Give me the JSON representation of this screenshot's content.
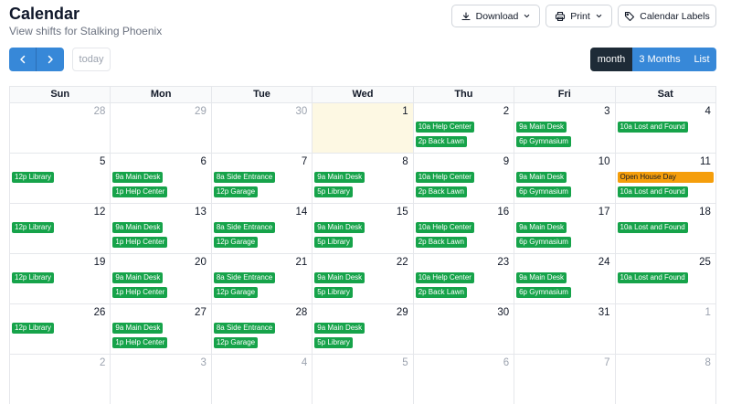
{
  "header": {
    "title": "Calendar",
    "subtitle": "View shifts for Stalking Phoenix"
  },
  "toolbar": {
    "download_label": "Download",
    "print_label": "Print",
    "labels_label": "Calendar Labels",
    "today_label": "today",
    "views": [
      "month",
      "3 Months",
      "List"
    ],
    "active_view": "month"
  },
  "icons": {
    "download": "download-icon",
    "print": "printer-icon",
    "labels": "tag-icon",
    "prev": "chevron-left-icon",
    "next": "chevron-right-icon"
  },
  "colors": {
    "accent": "#3788d8",
    "active_view": "#1e2b37",
    "event": "#16a34a",
    "special_event": "#f59e0b",
    "today_bg": "#fdf8e3"
  },
  "calendar": {
    "weekdays": [
      "Sun",
      "Mon",
      "Tue",
      "Wed",
      "Thu",
      "Fri",
      "Sat"
    ],
    "weeks": [
      [
        {
          "day": "28",
          "other": true,
          "events": []
        },
        {
          "day": "29",
          "other": true,
          "events": []
        },
        {
          "day": "30",
          "other": true,
          "events": []
        },
        {
          "day": "1",
          "today": true,
          "events": []
        },
        {
          "day": "2",
          "events": [
            "10a Help Center",
            "2p Back Lawn"
          ]
        },
        {
          "day": "3",
          "events": [
            "9a Main Desk",
            "6p Gymnasium"
          ]
        },
        {
          "day": "4",
          "events": [
            "10a Lost and Found"
          ]
        }
      ],
      [
        {
          "day": "5",
          "events": [
            "12p Library"
          ]
        },
        {
          "day": "6",
          "events": [
            "9a Main Desk",
            "1p Help Center"
          ]
        },
        {
          "day": "7",
          "events": [
            "8a Side Entrance",
            "12p Garage"
          ]
        },
        {
          "day": "8",
          "events": [
            "9a Main Desk",
            "5p Library"
          ]
        },
        {
          "day": "9",
          "events": [
            "10a Help Center",
            "2p Back Lawn"
          ]
        },
        {
          "day": "10",
          "events": [
            "9a Main Desk",
            "6p Gymnasium"
          ]
        },
        {
          "day": "11",
          "special": "Open House Day",
          "events": [
            "10a Lost and Found"
          ]
        }
      ],
      [
        {
          "day": "12",
          "events": [
            "12p Library"
          ]
        },
        {
          "day": "13",
          "events": [
            "9a Main Desk",
            "1p Help Center"
          ]
        },
        {
          "day": "14",
          "events": [
            "8a Side Entrance",
            "12p Garage"
          ]
        },
        {
          "day": "15",
          "events": [
            "9a Main Desk",
            "5p Library"
          ]
        },
        {
          "day": "16",
          "events": [
            "10a Help Center",
            "2p Back Lawn"
          ]
        },
        {
          "day": "17",
          "events": [
            "9a Main Desk",
            "6p Gymnasium"
          ]
        },
        {
          "day": "18",
          "events": [
            "10a Lost and Found"
          ]
        }
      ],
      [
        {
          "day": "19",
          "events": [
            "12p Library"
          ]
        },
        {
          "day": "20",
          "events": [
            "9a Main Desk",
            "1p Help Center"
          ]
        },
        {
          "day": "21",
          "events": [
            "8a Side Entrance",
            "12p Garage"
          ]
        },
        {
          "day": "22",
          "events": [
            "9a Main Desk",
            "5p Library"
          ]
        },
        {
          "day": "23",
          "events": [
            "10a Help Center",
            "2p Back Lawn"
          ]
        },
        {
          "day": "24",
          "events": [
            "9a Main Desk",
            "6p Gymnasium"
          ]
        },
        {
          "day": "25",
          "events": [
            "10a Lost and Found"
          ]
        }
      ],
      [
        {
          "day": "26",
          "events": [
            "12p Library"
          ]
        },
        {
          "day": "27",
          "events": [
            "9a Main Desk",
            "1p Help Center"
          ]
        },
        {
          "day": "28",
          "events": [
            "8a Side Entrance",
            "12p Garage"
          ]
        },
        {
          "day": "29",
          "events": [
            "9a Main Desk",
            "5p Library"
          ]
        },
        {
          "day": "30",
          "events": []
        },
        {
          "day": "31",
          "events": []
        },
        {
          "day": "1",
          "other": true,
          "events": []
        }
      ],
      [
        {
          "day": "2",
          "other": true,
          "events": []
        },
        {
          "day": "3",
          "other": true,
          "events": []
        },
        {
          "day": "4",
          "other": true,
          "events": []
        },
        {
          "day": "5",
          "other": true,
          "events": []
        },
        {
          "day": "6",
          "other": true,
          "events": []
        },
        {
          "day": "7",
          "other": true,
          "events": []
        },
        {
          "day": "8",
          "other": true,
          "events": []
        }
      ]
    ]
  }
}
